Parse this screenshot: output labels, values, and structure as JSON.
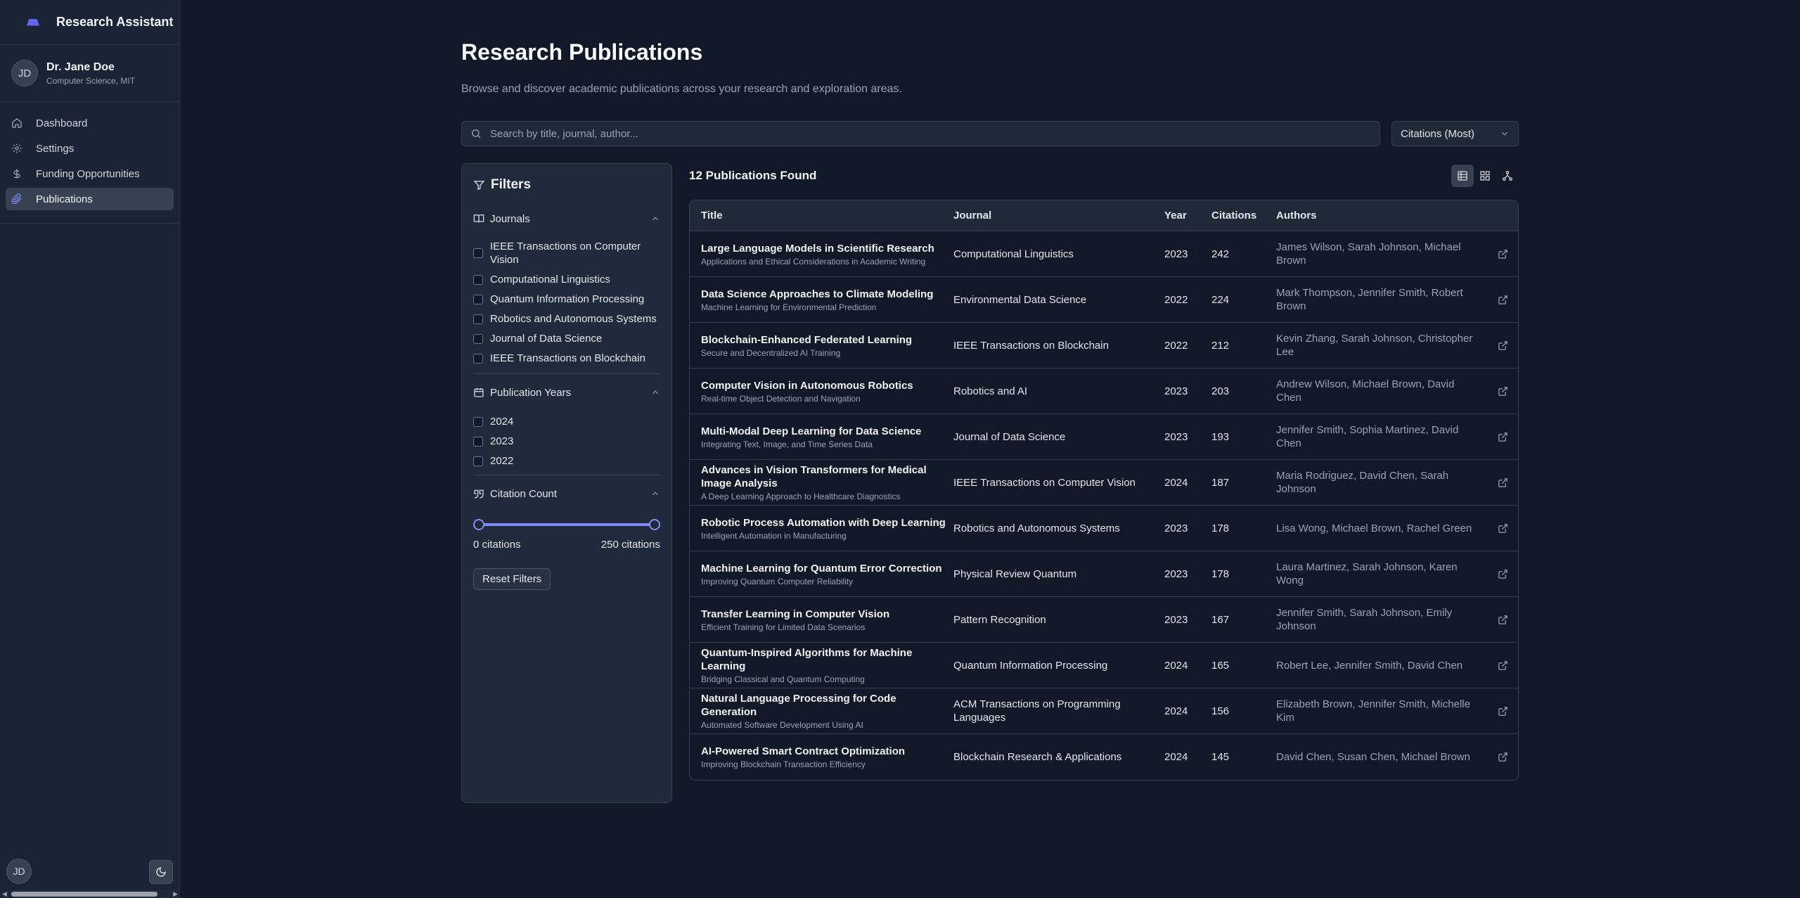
{
  "app": {
    "title": "Research Assistant"
  },
  "user": {
    "initials": "JD",
    "name": "Dr. Jane Doe",
    "affiliation": "Computer Science, MIT"
  },
  "nav": [
    {
      "label": "Dashboard",
      "icon": "home-icon",
      "active": false
    },
    {
      "label": "Settings",
      "icon": "gear-icon",
      "active": false
    },
    {
      "label": "Funding Opportunities",
      "icon": "dollar-icon",
      "active": false
    },
    {
      "label": "Publications",
      "icon": "paperclip-icon",
      "active": true
    }
  ],
  "page": {
    "title": "Research Publications",
    "subtitle": "Browse and discover academic publications across your research and exploration areas."
  },
  "search": {
    "placeholder": "Search by title, journal, author...",
    "value": ""
  },
  "sort": {
    "selected": "Citations (Most)"
  },
  "filters": {
    "title": "Filters",
    "journals_label": "Journals",
    "journals": [
      "IEEE Transactions on Computer Vision",
      "Computational Linguistics",
      "Quantum Information Processing",
      "Robotics and Autonomous Systems",
      "Journal of Data Science",
      "IEEE Transactions on Blockchain"
    ],
    "years_label": "Publication Years",
    "years": [
      "2024",
      "2023",
      "2022"
    ],
    "citation_label": "Citation Count",
    "citation_min": "0 citations",
    "citation_max": "250 citations",
    "citation_range_fraction": [
      0,
      1
    ],
    "reset_label": "Reset Filters"
  },
  "results": {
    "count_label": "12 Publications Found",
    "columns": [
      "Title",
      "Journal",
      "Year",
      "Citations",
      "Authors"
    ],
    "rows": [
      {
        "title": "Large Language Models in Scientific Research",
        "subtitle": "Applications and Ethical Considerations in Academic Writing",
        "journal": "Computational Linguistics",
        "year": "2023",
        "citations": "242",
        "authors": "James Wilson, Sarah Johnson, Michael Brown"
      },
      {
        "title": "Data Science Approaches to Climate Modeling",
        "subtitle": "Machine Learning for Environmental Prediction",
        "journal": "Environmental Data Science",
        "year": "2022",
        "citations": "224",
        "authors": "Mark Thompson, Jennifer Smith, Robert Brown"
      },
      {
        "title": "Blockchain-Enhanced Federated Learning",
        "subtitle": "Secure and Decentralized AI Training",
        "journal": "IEEE Transactions on Blockchain",
        "year": "2022",
        "citations": "212",
        "authors": "Kevin Zhang, Sarah Johnson, Christopher Lee"
      },
      {
        "title": "Computer Vision in Autonomous Robotics",
        "subtitle": "Real-time Object Detection and Navigation",
        "journal": "Robotics and AI",
        "year": "2023",
        "citations": "203",
        "authors": "Andrew Wilson, Michael Brown, David Chen"
      },
      {
        "title": "Multi-Modal Deep Learning for Data Science",
        "subtitle": "Integrating Text, Image, and Time Series Data",
        "journal": "Journal of Data Science",
        "year": "2023",
        "citations": "193",
        "authors": "Jennifer Smith, Sophia Martinez, David Chen"
      },
      {
        "title": "Advances in Vision Transformers for Medical Image Analysis",
        "subtitle": "A Deep Learning Approach to Healthcare Diagnostics",
        "journal": "IEEE Transactions on Computer Vision",
        "year": "2024",
        "citations": "187",
        "authors": "Maria Rodriguez, David Chen, Sarah Johnson"
      },
      {
        "title": "Robotic Process Automation with Deep Learning",
        "subtitle": "Intelligent Automation in Manufacturing",
        "journal": "Robotics and Autonomous Systems",
        "year": "2023",
        "citations": "178",
        "authors": "Lisa Wong, Michael Brown, Rachel Green"
      },
      {
        "title": "Machine Learning for Quantum Error Correction",
        "subtitle": "Improving Quantum Computer Reliability",
        "journal": "Physical Review Quantum",
        "year": "2023",
        "citations": "178",
        "authors": "Laura Martinez, Sarah Johnson, Karen Wong"
      },
      {
        "title": "Transfer Learning in Computer Vision",
        "subtitle": "Efficient Training for Limited Data Scenarios",
        "journal": "Pattern Recognition",
        "year": "2023",
        "citations": "167",
        "authors": "Jennifer Smith, Sarah Johnson, Emily Johnson"
      },
      {
        "title": "Quantum-Inspired Algorithms for Machine Learning",
        "subtitle": "Bridging Classical and Quantum Computing",
        "journal": "Quantum Information Processing",
        "year": "2024",
        "citations": "165",
        "authors": "Robert Lee, Jennifer Smith, David Chen"
      },
      {
        "title": "Natural Language Processing for Code Generation",
        "subtitle": "Automated Software Development Using AI",
        "journal": "ACM Transactions on Programming Languages",
        "year": "2024",
        "citations": "156",
        "authors": "Elizabeth Brown, Jennifer Smith, Michelle Kim"
      },
      {
        "title": "AI-Powered Smart Contract Optimization",
        "subtitle": "Improving Blockchain Transaction Efficiency",
        "journal": "Blockchain Research & Applications",
        "year": "2024",
        "citations": "145",
        "authors": "David Chen, Susan Chen, Michael Brown"
      }
    ]
  },
  "colors": {
    "accent": "#818cf8",
    "background": "#111827",
    "sidebar": "#1b2436"
  }
}
